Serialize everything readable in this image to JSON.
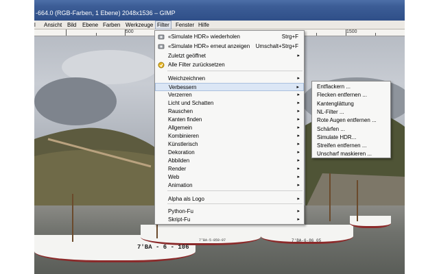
{
  "window": {
    "title": "-664.0 (RGB-Farben, 1 Ebene) 2048x1536 – GIMP"
  },
  "menubar": [
    "l",
    "Ansicht",
    "Bild",
    "Ebene",
    "Farben",
    "Werkzeuge",
    "Filter",
    "Fenster",
    "Hilfe"
  ],
  "ruler": {
    "marks": [
      "500",
      "1500"
    ]
  },
  "filter_menu": {
    "items": [
      {
        "label": "«Simulate HDR» wiederholen",
        "accel": "Strg+F",
        "icon": "repeat-icon"
      },
      {
        "label": "«Simulate HDR» erneut anzeigen",
        "accel": "Umschalt+Strg+F",
        "icon": "reshow-icon"
      },
      {
        "label": "Zuletzt geöffnet",
        "submenu": true
      },
      {
        "label": "Alle Filter zurücksetzen",
        "icon": "reset-icon"
      },
      {
        "label": "Weichzeichnen",
        "submenu": true
      },
      {
        "label": "Verbessern",
        "submenu": true,
        "highlighted": true
      },
      {
        "label": "Verzerren",
        "submenu": true
      },
      {
        "label": "Licht und Schatten",
        "submenu": true
      },
      {
        "label": "Rauschen",
        "submenu": true
      },
      {
        "label": "Kanten finden",
        "submenu": true
      },
      {
        "label": "Allgemein",
        "submenu": true
      },
      {
        "label": "Kombinieren",
        "submenu": true
      },
      {
        "label": "Künstlerisch",
        "submenu": true
      },
      {
        "label": "Dekoration",
        "submenu": true
      },
      {
        "label": "Abbilden",
        "submenu": true
      },
      {
        "label": "Render",
        "submenu": true
      },
      {
        "label": "Web",
        "submenu": true
      },
      {
        "label": "Animation",
        "submenu": true
      },
      {
        "label": "Alpha als Logo",
        "submenu": true
      },
      {
        "label": "Python-Fu",
        "submenu": true
      },
      {
        "label": "Skript-Fu",
        "submenu": true
      }
    ]
  },
  "verbessern_submenu": {
    "items": [
      "Entflackern ...",
      "Flecken entfernen ...",
      "Kantenglättung",
      "NL-Filter ...",
      "Rote Augen entfernen ...",
      "Schärfen ...",
      "Simulate HDR...",
      "Streifen entfernen ...",
      "Unscharf maskieren ..."
    ]
  },
  "boat_labels": [
    "7'BA - 6 - 106",
    "7'BA-5-859-07",
    "7'BA-6-86 05"
  ],
  "colors": {
    "titlebar": "#3c5d96",
    "menu_highlight": "#dbe6f5",
    "menu_bg": "#f7f7f6"
  }
}
